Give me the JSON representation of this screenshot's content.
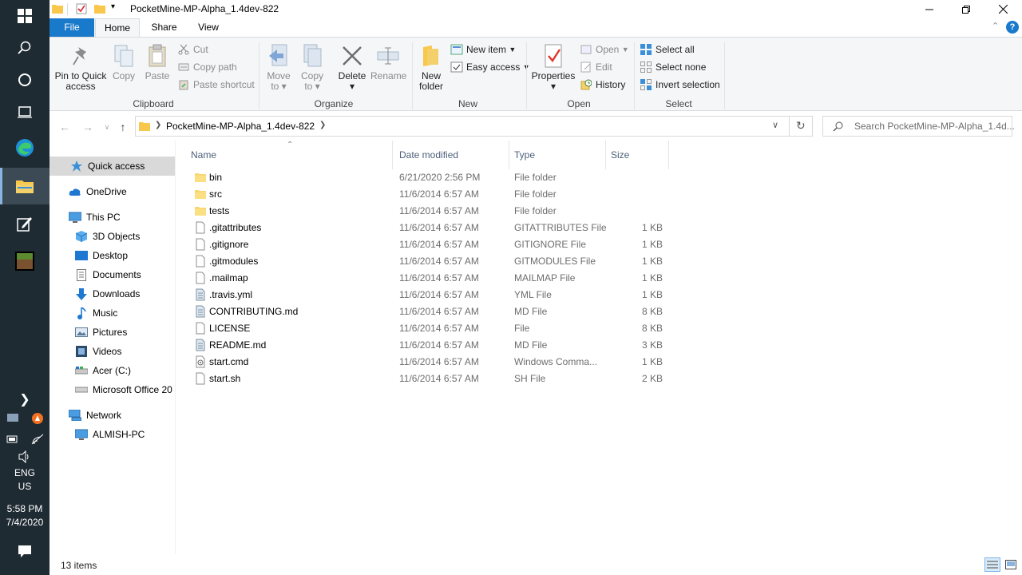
{
  "window": {
    "title": "PocketMine-MP-Alpha_1.4dev-822"
  },
  "tabs": [
    {
      "label": "File"
    },
    {
      "label": "Home"
    },
    {
      "label": "Share"
    },
    {
      "label": "View"
    }
  ],
  "ribbon": {
    "clipboard": {
      "label": "Clipboard",
      "pin_line1": "Pin to Quick",
      "pin_line2": "access",
      "copy": "Copy",
      "paste": "Paste",
      "cut": "Cut",
      "copy_path": "Copy path",
      "paste_shortcut": "Paste shortcut"
    },
    "organize": {
      "label": "Organize",
      "move_line1": "Move",
      "move_line2": "to",
      "copy_line1": "Copy",
      "copy_line2": "to",
      "delete": "Delete",
      "rename": "Rename"
    },
    "new": {
      "label": "New",
      "folder_line1": "New",
      "folder_line2": "folder",
      "new_item": "New item",
      "easy_access": "Easy access"
    },
    "open": {
      "label": "Open",
      "properties": "Properties",
      "open": "Open",
      "edit": "Edit",
      "history": "History"
    },
    "select": {
      "label": "Select",
      "select_all": "Select all",
      "select_none": "Select none",
      "invert": "Invert selection"
    }
  },
  "address": {
    "path": "PocketMine-MP-Alpha_1.4dev-822",
    "search_placeholder": "Search PocketMine-MP-Alpha_1.4d..."
  },
  "nav": [
    {
      "label": "Quick access",
      "icon": "star-icon"
    },
    {
      "label": "OneDrive",
      "icon": "cloud-icon"
    },
    {
      "label": "This PC",
      "icon": "computer-icon"
    },
    {
      "label": "3D Objects",
      "icon": "cube-icon"
    },
    {
      "label": "Desktop",
      "icon": "desktop-icon"
    },
    {
      "label": "Documents",
      "icon": "document-icon"
    },
    {
      "label": "Downloads",
      "icon": "download-icon"
    },
    {
      "label": "Music",
      "icon": "music-icon"
    },
    {
      "label": "Pictures",
      "icon": "pictures-icon"
    },
    {
      "label": "Videos",
      "icon": "video-icon"
    },
    {
      "label": "Acer (C:)",
      "icon": "drive-icon"
    },
    {
      "label": "Microsoft Office 20",
      "icon": "drive-icon"
    },
    {
      "label": "Network",
      "icon": "network-icon"
    },
    {
      "label": "ALMISH-PC",
      "icon": "computer-icon"
    }
  ],
  "columns": {
    "name": "Name",
    "date": "Date modified",
    "type": "Type",
    "size": "Size"
  },
  "files": [
    {
      "name": "bin",
      "date": "6/21/2020 2:56 PM",
      "type": "File folder",
      "size": "",
      "icon": "folder"
    },
    {
      "name": "src",
      "date": "11/6/2014 6:57 AM",
      "type": "File folder",
      "size": "",
      "icon": "folder"
    },
    {
      "name": "tests",
      "date": "11/6/2014 6:57 AM",
      "type": "File folder",
      "size": "",
      "icon": "folder"
    },
    {
      "name": ".gitattributes",
      "date": "11/6/2014 6:57 AM",
      "type": "GITATTRIBUTES File",
      "size": "1 KB",
      "icon": "file"
    },
    {
      "name": ".gitignore",
      "date": "11/6/2014 6:57 AM",
      "type": "GITIGNORE File",
      "size": "1 KB",
      "icon": "file"
    },
    {
      "name": ".gitmodules",
      "date": "11/6/2014 6:57 AM",
      "type": "GITMODULES File",
      "size": "1 KB",
      "icon": "file"
    },
    {
      "name": ".mailmap",
      "date": "11/6/2014 6:57 AM",
      "type": "MAILMAP File",
      "size": "1 KB",
      "icon": "file"
    },
    {
      "name": ".travis.yml",
      "date": "11/6/2014 6:57 AM",
      "type": "YML File",
      "size": "1 KB",
      "icon": "textfile"
    },
    {
      "name": "CONTRIBUTING.md",
      "date": "11/6/2014 6:57 AM",
      "type": "MD File",
      "size": "8 KB",
      "icon": "textfile"
    },
    {
      "name": "LICENSE",
      "date": "11/6/2014 6:57 AM",
      "type": "File",
      "size": "8 KB",
      "icon": "file"
    },
    {
      "name": "README.md",
      "date": "11/6/2014 6:57 AM",
      "type": "MD File",
      "size": "3 KB",
      "icon": "textfile"
    },
    {
      "name": "start.cmd",
      "date": "11/6/2014 6:57 AM",
      "type": "Windows Comma...",
      "size": "1 KB",
      "icon": "cmd"
    },
    {
      "name": "start.sh",
      "date": "11/6/2014 6:57 AM",
      "type": "SH File",
      "size": "2 KB",
      "icon": "file"
    }
  ],
  "status": {
    "count": "13 items"
  },
  "tray": {
    "lang1": "ENG",
    "lang2": "US",
    "time": "5:58 PM",
    "date": "7/4/2020"
  },
  "colors": {
    "accent": "#1979ca",
    "taskbar": "#1f2b33",
    "folder": "#f8d775",
    "selected": "#d9d9d9"
  }
}
